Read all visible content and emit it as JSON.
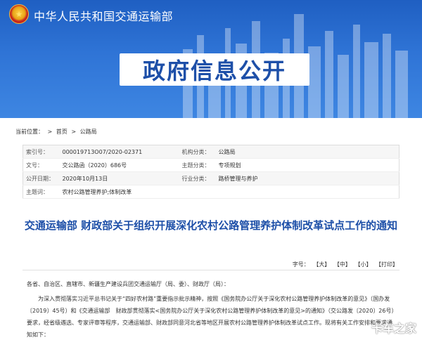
{
  "header": {
    "ministry_name": "中华人民共和国交通运输部",
    "banner_title": "政府信息公开"
  },
  "breadcrumb": {
    "current_label": "当前位置：",
    "items": [
      "首页",
      "公路局"
    ],
    "separator": ">"
  },
  "meta": {
    "rows": [
      {
        "k1": "索引号：",
        "v1": "000019713O07/2020-02371",
        "k2": "机构分类：",
        "v2": "公路局"
      },
      {
        "k1": "文号：",
        "v1": "交公路函（2020）686号",
        "k2": "主题分类：",
        "v2": "专项规划"
      },
      {
        "k1": "公开日期：",
        "v1": "2020年10月13日",
        "k2": "行业分类：",
        "v2": "路桥管理与养护"
      },
      {
        "k1": "主题词：",
        "v1": "农村公路管理养护;体制改革",
        "k2": "",
        "v2": ""
      }
    ]
  },
  "document": {
    "title": "交通运输部 财政部关于组织开展深化农村公路管理养护体制改革试点工作的通知"
  },
  "font_controls": {
    "label": "字号：",
    "large": "【大】",
    "medium": "【中】",
    "small": "【小】",
    "print": "【打印】"
  },
  "body": {
    "addressee": "各省、自治区、直辖市、新疆生产建设兵团交通运输厅（局、委）、财政厅（局）：",
    "paragraph": "为深入贯彻落实习近平总书记关于“四好农村路”重要指示批示精神，按照《国务院办公厅关于深化农村公路管理养护体制改革的意见》（国办发〔2019〕45号）和《交通运输部　财政部贯彻落实<国务院办公厅关于深化农村公路管理养护体制改革的意见>的通知》（交公路发〔2020〕26号）要求，经省级遴选、专家评审等程序，交通运输部、财政部同意河北省等地区开展农村公路管理养护体制改革试点工作。现将有关工作安排和要求通知如下："
  },
  "watermark": "卡车之家"
}
